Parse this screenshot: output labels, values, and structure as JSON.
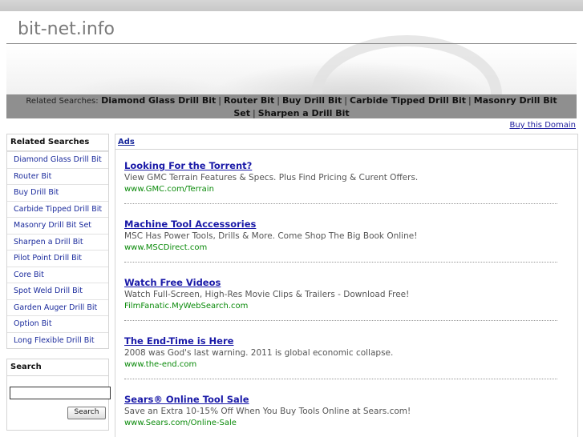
{
  "site": {
    "title": "bit-net.info"
  },
  "related_bar": {
    "label": "Related Searches:",
    "items": [
      "Diamond Glass Drill Bit",
      "Router Bit",
      "Buy Drill Bit",
      "Carbide Tipped Drill Bit",
      "Masonry Drill Bit Set",
      "Sharpen a Drill Bit"
    ],
    "separator": "|"
  },
  "buy_domain": "Buy this Domain",
  "sidebar": {
    "heading": "Related Searches",
    "items": [
      "Diamond Glass Drill Bit",
      "Router Bit",
      "Buy Drill Bit",
      "Carbide Tipped Drill Bit",
      "Masonry Drill Bit Set",
      "Sharpen a Drill Bit",
      "Pilot Point Drill Bit",
      "Core Bit",
      "Spot Weld Drill Bit",
      "Garden Auger Drill Bit",
      "Option Bit",
      "Long Flexible Drill Bit"
    ]
  },
  "search": {
    "heading": "Search",
    "value": "",
    "button_label": "Search"
  },
  "ads": {
    "label": "Ads",
    "items": [
      {
        "title": "Looking For the Torrent?",
        "desc": "View GMC Terrain Features & Specs. Plus Find Pricing & Curent Offers.",
        "url": "www.GMC.com/Terrain"
      },
      {
        "title": "Machine Tool Accessories",
        "desc": "MSC Has Power Tools, Drills & More. Come Shop The Big Book Online!",
        "url": "www.MSCDirect.com"
      },
      {
        "title": "Watch Free Videos",
        "desc": "Watch Full-Screen, High-Res Movie Clips & Trailers - Download Free!",
        "url": "FilmFanatic.MyWebSearch.com"
      },
      {
        "title": "The End-Time is Here",
        "desc": "2008 was God's last warning. 2011 is global economic collapse.",
        "url": "www.the-end.com"
      },
      {
        "title": "Sears® Online Tool Sale",
        "desc": "Save an Extra 10-15% Off When You Buy Tools Online at Sears.com!",
        "url": "www.Sears.com/Online-Sale"
      }
    ]
  }
}
